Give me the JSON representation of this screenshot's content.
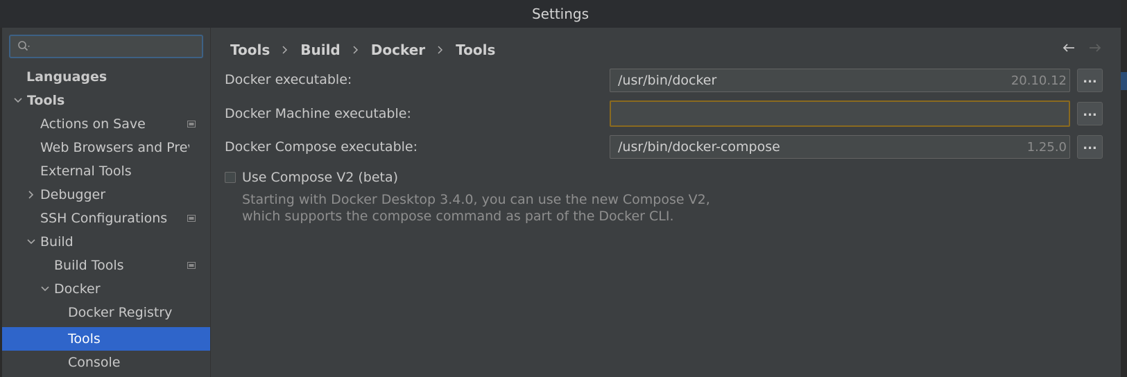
{
  "window": {
    "title": "Settings"
  },
  "search": {
    "placeholder": "",
    "value": ""
  },
  "sidebar": {
    "items": [
      {
        "label": "Languages",
        "level": 0,
        "bold": true,
        "arrow": "none"
      },
      {
        "label": "Tools",
        "level": 0,
        "bold": true,
        "arrow": "expanded"
      },
      {
        "label": "Actions on Save",
        "level": 1,
        "arrow": "none",
        "settings_icon": true
      },
      {
        "label": "Web Browsers and Prev",
        "level": 1,
        "arrow": "none"
      },
      {
        "label": "External Tools",
        "level": 1,
        "arrow": "none"
      },
      {
        "label": "Debugger",
        "level": 1,
        "arrow": "collapsed"
      },
      {
        "label": "SSH Configurations",
        "level": 1,
        "arrow": "none",
        "settings_icon": true
      },
      {
        "label": "Build",
        "level": 1,
        "arrow": "expanded"
      },
      {
        "label": "Build Tools",
        "level": 2,
        "arrow": "none",
        "settings_icon": true
      },
      {
        "label": "Docker",
        "level": 2,
        "arrow": "expanded"
      },
      {
        "label": "Docker Registry",
        "level": 3,
        "arrow": "none"
      },
      {
        "label": "Tools",
        "level": 3,
        "arrow": "none",
        "selected": true
      },
      {
        "label": "Console",
        "level": 3,
        "arrow": "none"
      }
    ]
  },
  "breadcrumb": [
    "Tools",
    "Build",
    "Docker",
    "Tools"
  ],
  "form": {
    "docker_exec": {
      "label": "Docker executable:",
      "value": "/usr/bin/docker",
      "version": "20.10.12",
      "browse": "..."
    },
    "machine_exec": {
      "label": "Docker Machine executable:",
      "value": "",
      "version": "",
      "browse": "..."
    },
    "compose_exec": {
      "label": "Docker Compose executable:",
      "value": "/usr/bin/docker-compose",
      "version": "1.25.0",
      "browse": "..."
    },
    "compose_v2": {
      "label": "Use Compose V2 (beta)",
      "checked": false,
      "help_line1": "Starting with Docker Desktop 3.4.0, you can use the new Compose V2,",
      "help_line2": "which supports the compose command as part of the Docker CLI."
    }
  },
  "colors": {
    "background": "#3c3f41",
    "selection": "#2f65ca",
    "focus_border": "#8a6a1f",
    "search_border": "#3d6185"
  }
}
